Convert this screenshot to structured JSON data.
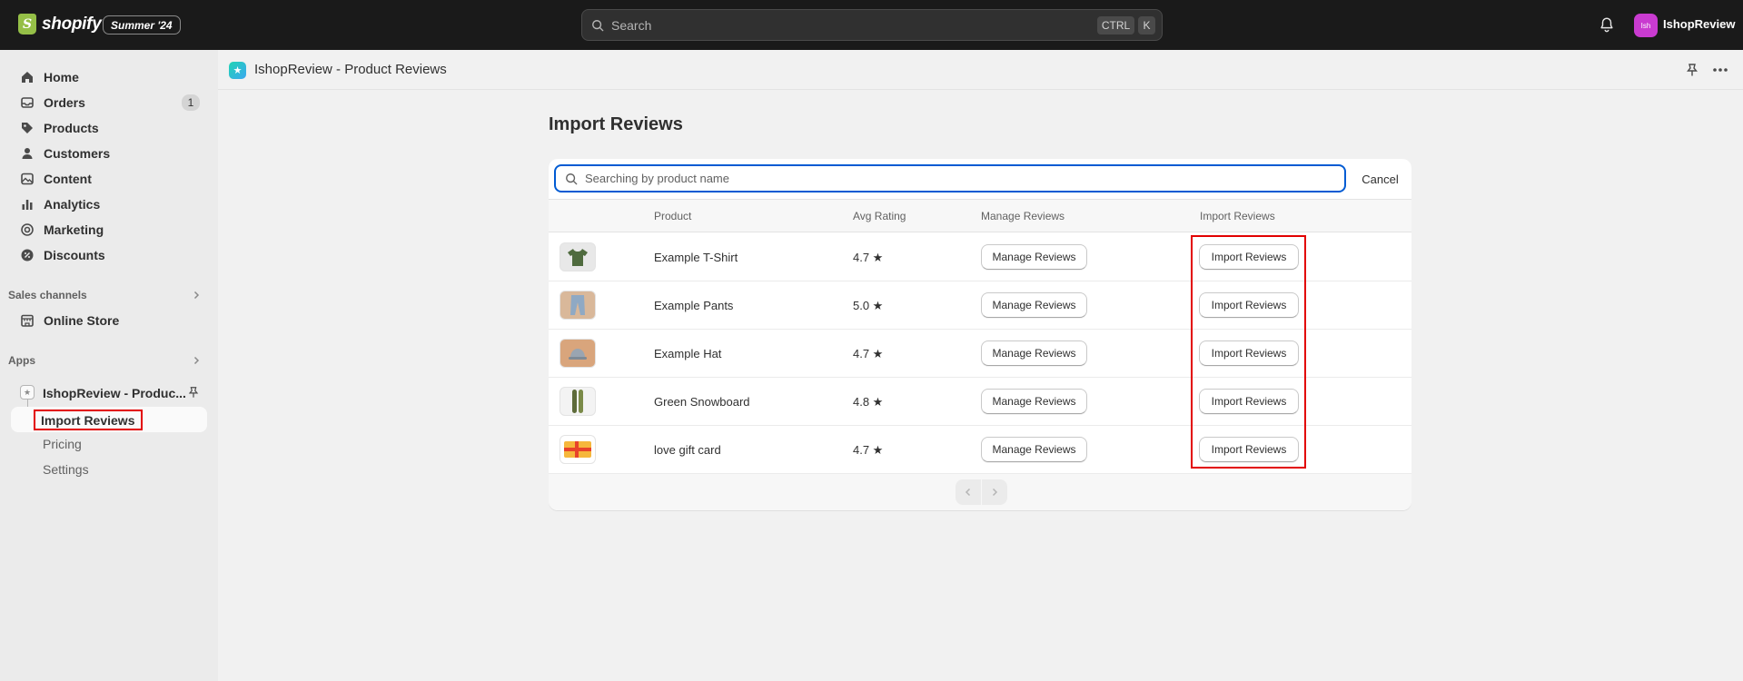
{
  "topbar": {
    "logo_text": "shopify",
    "logo_glyph": "S",
    "edition": "Summer '24",
    "search_placeholder": "Search",
    "shortcut_ctrl": "CTRL",
    "shortcut_k": "K",
    "avatar_initials": "Ish",
    "store_name": "IshopReview",
    "avatar_color": "#c93bd0"
  },
  "sidebar": {
    "nav": [
      {
        "label": "Home",
        "icon": "home-icon"
      },
      {
        "label": "Orders",
        "icon": "orders-icon",
        "badge": "1"
      },
      {
        "label": "Products",
        "icon": "tag-icon"
      },
      {
        "label": "Customers",
        "icon": "person-icon"
      },
      {
        "label": "Content",
        "icon": "content-icon"
      },
      {
        "label": "Analytics",
        "icon": "bar-chart-icon"
      },
      {
        "label": "Marketing",
        "icon": "target-icon"
      },
      {
        "label": "Discounts",
        "icon": "discount-icon"
      }
    ],
    "sales_channels_label": "Sales channels",
    "online_store_label": "Online Store",
    "apps_label": "Apps",
    "app_name": "IshopReview - Produc...",
    "app_sub": [
      {
        "label": "Import Reviews",
        "active": true
      },
      {
        "label": "Pricing"
      },
      {
        "label": "Settings"
      }
    ]
  },
  "app_header": {
    "title": "IshopReview - Product Reviews"
  },
  "main": {
    "page_title": "Import Reviews",
    "search_placeholder": "Searching by product name",
    "cancel_label": "Cancel",
    "columns": [
      "Product",
      "Avg Rating",
      "Manage Reviews",
      "Import Reviews"
    ],
    "rows": [
      {
        "product": "Example T-Shirt",
        "rating": "4.7 ★",
        "manage": "Manage Reviews",
        "import": "Import Reviews",
        "thumb": "tshirt"
      },
      {
        "product": "Example Pants",
        "rating": "5.0 ★",
        "manage": "Manage Reviews",
        "import": "Import Reviews",
        "thumb": "pants"
      },
      {
        "product": "Example Hat",
        "rating": "4.7 ★",
        "manage": "Manage Reviews",
        "import": "Import Reviews",
        "thumb": "hat"
      },
      {
        "product": "Green Snowboard",
        "rating": "4.8 ★",
        "manage": "Manage Reviews",
        "import": "Import Reviews",
        "thumb": "snowboard"
      },
      {
        "product": "love gift card",
        "rating": "4.7 ★",
        "manage": "Manage Reviews",
        "import": "Import Reviews",
        "thumb": "giftcard"
      }
    ]
  },
  "colors": {
    "highlight": "#e20000",
    "focus": "#005bd3"
  }
}
